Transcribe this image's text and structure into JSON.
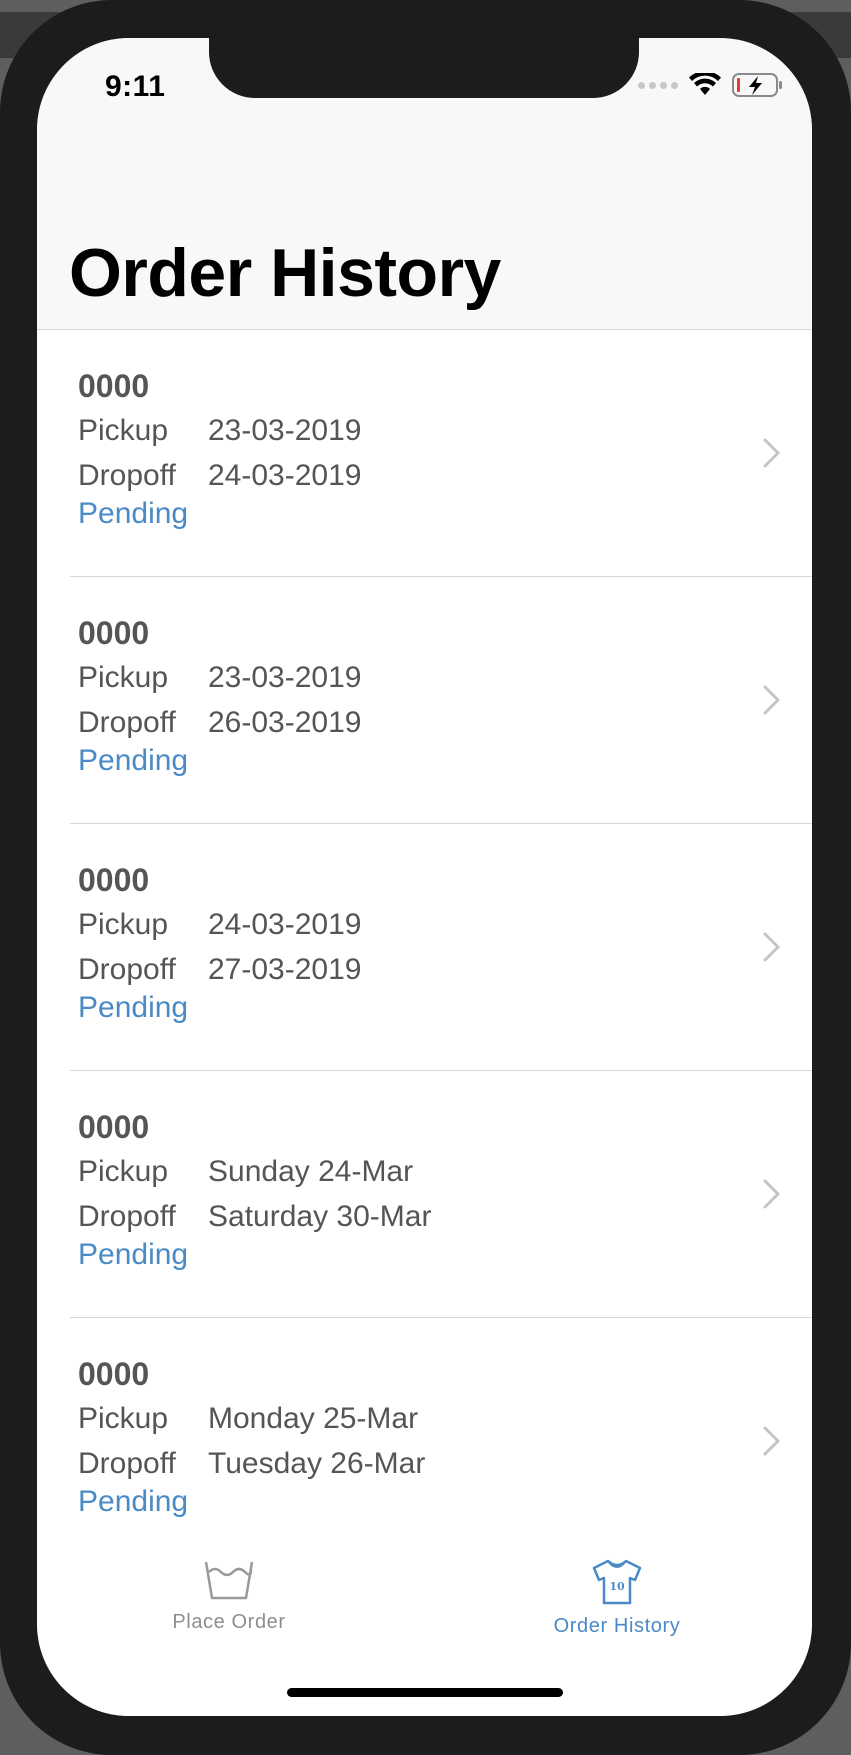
{
  "status_bar": {
    "time": "9:11"
  },
  "header": {
    "title": "Order History"
  },
  "orders": [
    {
      "id": "0000",
      "pickup_label": "Pickup",
      "pickup": "23-03-2019",
      "dropoff_label": "Dropoff",
      "dropoff": "24-03-2019",
      "status": "Pending"
    },
    {
      "id": "0000",
      "pickup_label": "Pickup",
      "pickup": "23-03-2019",
      "dropoff_label": "Dropoff",
      "dropoff": "26-03-2019",
      "status": "Pending"
    },
    {
      "id": "0000",
      "pickup_label": "Pickup",
      "pickup": "24-03-2019",
      "dropoff_label": "Dropoff",
      "dropoff": "27-03-2019",
      "status": "Pending"
    },
    {
      "id": "0000",
      "pickup_label": "Pickup",
      "pickup": "Sunday 24-Mar",
      "dropoff_label": "Dropoff",
      "dropoff": "Saturday 30-Mar",
      "status": "Pending"
    },
    {
      "id": "0000",
      "pickup_label": "Pickup",
      "pickup": "Monday 25-Mar",
      "dropoff_label": "Dropoff",
      "dropoff": "Tuesday 26-Mar",
      "status": "Pending"
    }
  ],
  "tabbar": {
    "tabs": [
      {
        "label": "Place Order",
        "icon": "washtub-icon",
        "active": false
      },
      {
        "label": "Order History",
        "icon": "jersey-icon",
        "active": true
      }
    ]
  },
  "colors": {
    "accent": "#4a8ac6",
    "text_secondary": "#555555",
    "tab_inactive": "#8e8e8e",
    "separator": "#d7d7d7"
  }
}
